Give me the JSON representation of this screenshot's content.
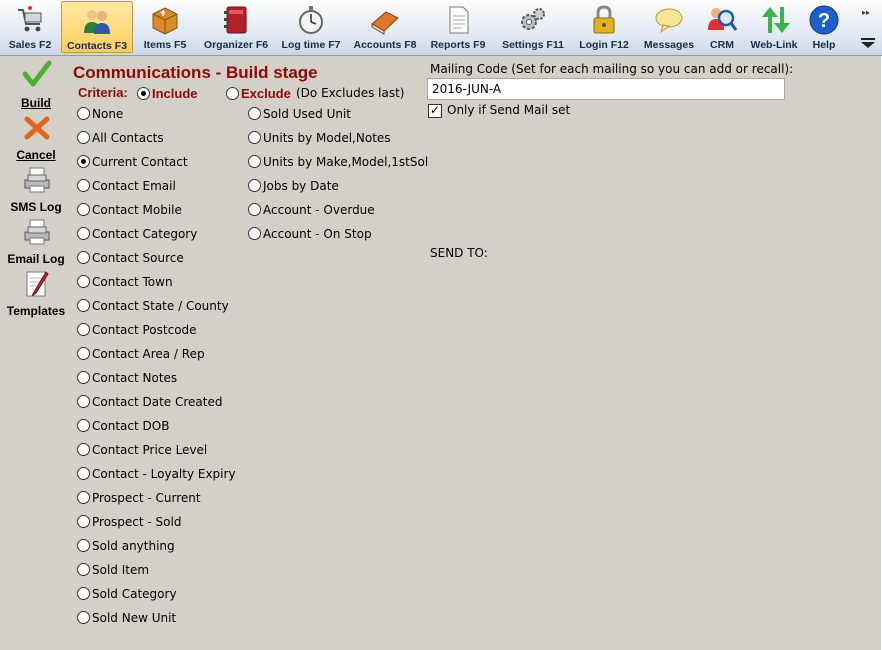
{
  "toolbar": {
    "buttons": [
      {
        "label": "Sales F2",
        "icon": "cart-icon"
      },
      {
        "label": "Contacts F3",
        "icon": "people-icon",
        "active": true
      },
      {
        "label": "Items F5",
        "icon": "box-icon"
      },
      {
        "label": "Organizer F6",
        "icon": "organizer-book-icon"
      },
      {
        "label": "Log time F7",
        "icon": "stopwatch-icon"
      },
      {
        "label": "Accounts F8",
        "icon": "ledger-book-icon"
      },
      {
        "label": "Reports F9",
        "icon": "document-icon"
      },
      {
        "label": "Settings F11",
        "icon": "gears-icon"
      },
      {
        "label": "Login F12",
        "icon": "padlock-icon"
      },
      {
        "label": "Messages",
        "icon": "speech-bubble-icon"
      },
      {
        "label": "CRM",
        "icon": "magnifier-person-icon"
      },
      {
        "label": "Web-Link",
        "icon": "up-down-arrows-icon"
      },
      {
        "label": "Help",
        "icon": "help-icon"
      }
    ],
    "corner_glyph": "▸▸"
  },
  "sidebar": {
    "build": "Build",
    "cancel": "Cancel",
    "sms_log": "SMS Log",
    "email_log": "Email Log",
    "templates": "Templates"
  },
  "page": {
    "heading": "Communications - Build stage",
    "criteria_label": "Criteria:",
    "include_label": "Include",
    "exclude_label": "Exclude",
    "exclude_note": "(Do Excludes last)"
  },
  "criteria_left": [
    "None",
    "All Contacts",
    "Current Contact",
    "Contact Email",
    "Contact Mobile",
    "Contact Category",
    "Contact Source",
    "Contact Town",
    "Contact State / County",
    "Contact Postcode",
    "Contact Area / Rep",
    "Contact Notes",
    "Contact Date Created",
    "Contact DOB",
    "Contact Price Level",
    "Contact - Loyalty Expiry",
    "Prospect - Current",
    "Prospect - Sold",
    "Sold anything",
    "Sold Item",
    "Sold Category",
    "Sold New Unit"
  ],
  "criteria_right": [
    "Sold Used Unit",
    "Units by Model,Notes",
    "Units by Make,Model,1stSol",
    "Jobs by Date",
    "Account - Overdue",
    "Account - On Stop"
  ],
  "selected_criterion": "Current Contact",
  "include_selected": true,
  "mailing": {
    "label": "Mailing Code (Set for each mailing so you can add or recall):",
    "value": "2016-JUN-A",
    "send_mail_label": "Only if Send Mail set",
    "send_mail_checked": true
  },
  "send_to_label": "SEND TO:",
  "colors": {
    "heading": "#8b0a0a",
    "background": "#d4d0c8",
    "active_tab": "#ffcf5c"
  }
}
